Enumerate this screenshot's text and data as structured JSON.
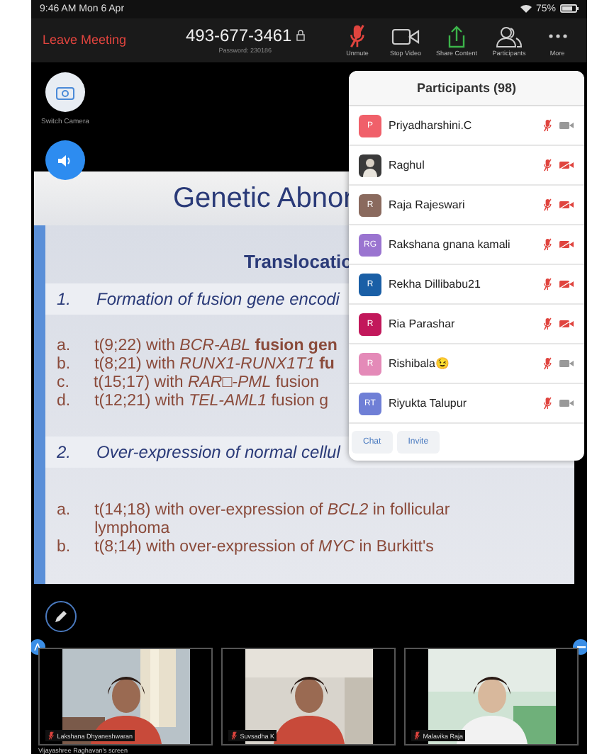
{
  "status_bar": {
    "time": "9:46 AM  Mon 6 Apr",
    "battery": "75%"
  },
  "top_bar": {
    "leave": "Leave Meeting",
    "meeting_id": "493-677-3461",
    "password": "Password: 230186",
    "tools": [
      {
        "kind": "mic",
        "label": "Unmute",
        "muted": true
      },
      {
        "kind": "video",
        "label": "Stop Video",
        "muted": false
      },
      {
        "kind": "share",
        "label": "Share Content",
        "muted": false
      },
      {
        "kind": "participants",
        "label": "Participants",
        "muted": false
      },
      {
        "kind": "more",
        "label": "More",
        "muted": false
      }
    ]
  },
  "side_controls": {
    "switch_camera": "Switch Camera"
  },
  "slide": {
    "title": "Genetic Abnor",
    "heading": "Translocatio",
    "point_1": {
      "number": "1.",
      "text": "Formation of fusion gene encodi"
    },
    "list_1": [
      {
        "letter": "a.",
        "text": "t(9;22) with *BCR-ABL* **fusion gen**"
      },
      {
        "letter": "b.",
        "text": "t(8;21) with *RUNX1-RUNX1T1* **fu**"
      },
      {
        "letter": "c.",
        "text": "t(15;17) with *RAR□-PML* fusion"
      },
      {
        "letter": "d.",
        "text": "t(12;21) with *TEL-AML1* fusion g"
      }
    ],
    "point_2": {
      "number": "2.",
      "text": "Over-expression of normal cellul"
    },
    "list_2": [
      {
        "letter": "a.",
        "text": "t(14;18) with over-expression of *BCL2* in follicular lymphoma"
      },
      {
        "letter": "b.",
        "text": "t(8;14) with over-expression of *MYC* in Burkitt's"
      }
    ]
  },
  "participants": {
    "title": "Participants (98)",
    "items": [
      {
        "name": "Priyadharshini.C",
        "avatar": {
          "kind": "initials",
          "text": "P",
          "color": "#f0606a"
        },
        "mic_muted": true,
        "video_off": false
      },
      {
        "name": "Raghul",
        "mic_muted": true,
        "video_off": true
      },
      {
        "name": "Raja Rajeswari",
        "avatar": {
          "kind": "initials",
          "text": "R",
          "color": "#8a6a5e"
        },
        "mic_muted": true,
        "video_off": true
      },
      {
        "name": "Rakshana gnana kamali",
        "avatar": {
          "kind": "initials",
          "text": "RG",
          "color": "#9a74d0"
        },
        "mic_muted": true,
        "video_off": true
      },
      {
        "name": "Rekha Dillibabu21",
        "avatar": {
          "kind": "initials",
          "text": "R",
          "color": "#1a5fa6"
        },
        "mic_muted": true,
        "video_off": true
      },
      {
        "name": "Ria Parashar",
        "avatar": {
          "kind": "initials",
          "text": "R",
          "color": "#c2185b"
        },
        "mic_muted": true,
        "video_off": true
      },
      {
        "name": "Rishibala😉",
        "avatar": {
          "kind": "initials",
          "text": "R",
          "color": "#e48ab8"
        },
        "mic_muted": true,
        "video_off": false
      },
      {
        "name": "Riyukta Talupur",
        "avatar": {
          "kind": "initials",
          "text": "RT",
          "color": "#6f7fd6"
        },
        "mic_muted": true,
        "video_off": false
      }
    ],
    "buttons": [
      "Chat",
      "Invite"
    ]
  },
  "videos": [
    {
      "name": "Lakshana Dhyaneshwaran",
      "mic_muted": true
    },
    {
      "name": "Suvsadha K",
      "mic_muted": true
    },
    {
      "name": "Malavika Raja",
      "mic_muted": true
    }
  ],
  "screen_caption": "Vijayashree Raghavan's screen"
}
